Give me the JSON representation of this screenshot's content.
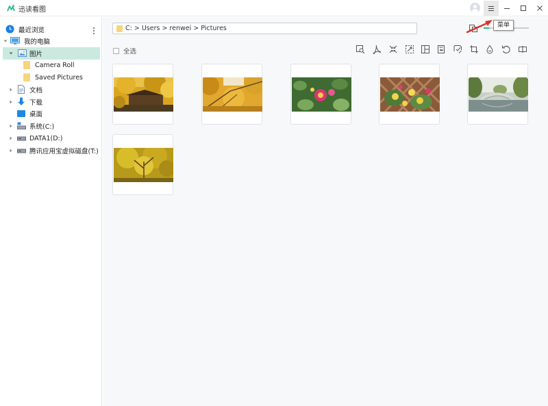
{
  "app": {
    "title": "迅读看图",
    "tooltip": "菜单",
    "colors": {
      "accent": "#2bb58a",
      "selected_bg": "#cbeadf",
      "folder": "#f7d57b"
    }
  },
  "sidebar": {
    "recent": "最近浏览",
    "computer": "我的电脑",
    "pictures": "图片",
    "camera_roll": "Camera Roll",
    "saved_pictures": "Saved Pictures",
    "documents": "文档",
    "downloads": "下载",
    "desktop": "桌面",
    "drive_c": "系统(C:)",
    "drive_d": "DATA1(D:)",
    "drive_t": "腾讯应用宝虚拟磁盘(T:)"
  },
  "main": {
    "path": "C:  >  Users  >  renwei  >  Pictures",
    "select_all": "全选",
    "zoom_level": 0.12,
    "toolbar_icons": [
      "search-image-icon",
      "pdf-icon",
      "compress-icon",
      "resize-icon",
      "collage-icon",
      "long-image-icon",
      "watermark-icon",
      "crop-icon",
      "color-icon",
      "rotate-icon",
      "split-icon"
    ],
    "thumbnails": [
      {
        "subject": "ginkgo-tree-building"
      },
      {
        "subject": "ginkgo-branches-sky"
      },
      {
        "subject": "pink-flower-leaves"
      },
      {
        "subject": "yellow-roses-trellis"
      },
      {
        "subject": "stone-bridge-willows"
      },
      {
        "subject": "ginkgo-canopy"
      }
    ]
  }
}
